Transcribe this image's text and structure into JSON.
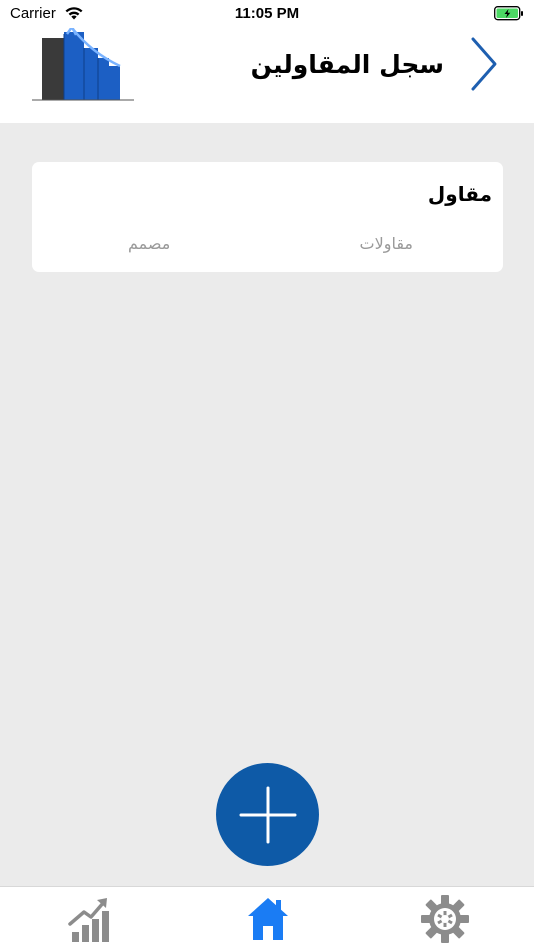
{
  "status_bar": {
    "carrier": "Carrier",
    "time": "11:05 PM"
  },
  "header": {
    "title": "سجل المقاولين",
    "back_icon": "chevron-right-icon",
    "logo_icon": "buildings-growth-logo"
  },
  "card": {
    "title": "مقاول",
    "types": [
      "مقاولات",
      "مصمم"
    ]
  },
  "fab": {
    "icon": "plus-icon"
  },
  "tab_bar": {
    "items": [
      {
        "icon": "chart-growth-icon",
        "active": false
      },
      {
        "icon": "home-icon",
        "active": true
      },
      {
        "icon": "gear-icon",
        "active": false
      }
    ]
  },
  "colors": {
    "brand_blue": "#0e5aa7",
    "active_tab": "#1a7cf4",
    "inactive_tab": "#8c8c8c",
    "background": "#ebebeb"
  }
}
